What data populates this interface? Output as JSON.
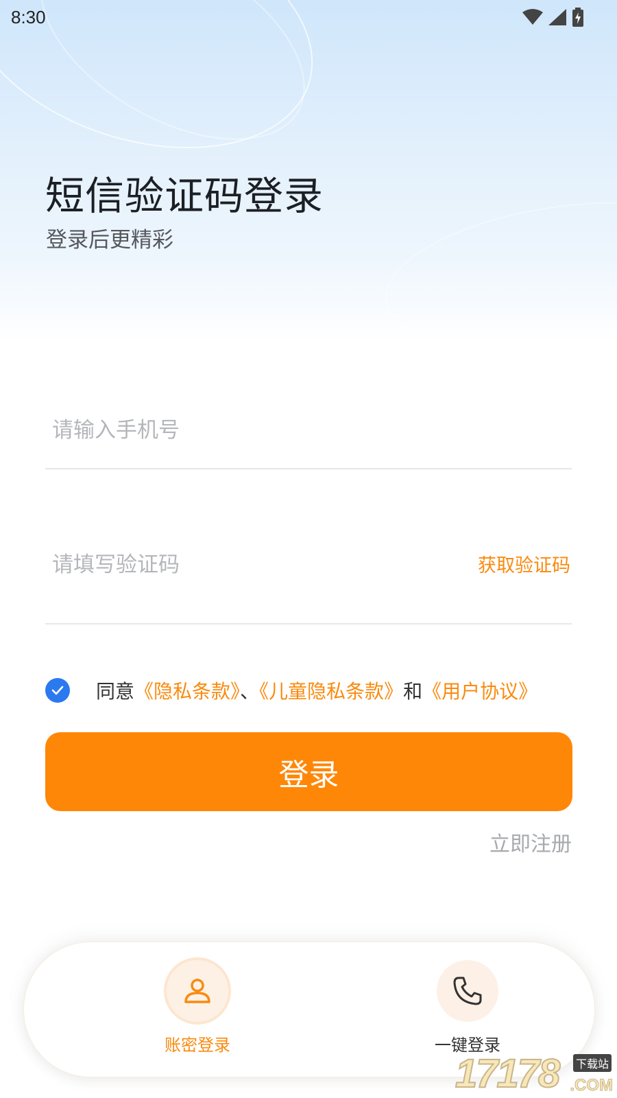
{
  "status_bar": {
    "time": "8:30"
  },
  "header": {
    "title": "短信验证码登录",
    "subtitle": "登录后更精彩"
  },
  "form": {
    "phone_placeholder": "请输入手机号",
    "code_placeholder": "请填写验证码",
    "get_code_label": "获取验证码"
  },
  "agreement": {
    "checked": true,
    "prefix": "同意",
    "privacy_link": "《隐私条款》",
    "sep1": "、",
    "child_privacy_link": "《儿童隐私条款》",
    "sep2": "和",
    "user_agreement_link": "《用户协议》"
  },
  "login_button": "登录",
  "register_link": "立即注册",
  "login_options": {
    "account_label": "账密登录",
    "quick_label": "一键登录"
  },
  "watermark": {
    "number": "17178",
    "tag": "下载站",
    "suffix": ".COM"
  },
  "colors": {
    "accent": "#ff8707",
    "link": "#fa8a0e",
    "check": "#2b79ee"
  }
}
